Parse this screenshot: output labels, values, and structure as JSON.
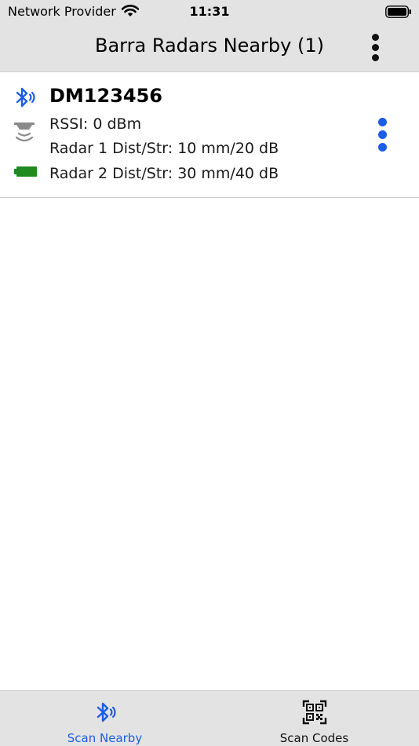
{
  "status_bar": {
    "carrier": "Network Provider",
    "time": "11:31"
  },
  "header": {
    "title": "Barra Radars Nearby (1)"
  },
  "device": {
    "name": "DM123456",
    "rssi": "RSSI: 0 dBm",
    "radar1": "Radar 1 Dist/Str: 10 mm/20 dB",
    "radar2": "Radar 2 Dist/Str: 30 mm/40 dB"
  },
  "tabs": [
    {
      "label": "Scan Nearby",
      "icon": "bluetooth-icon",
      "selected": true
    },
    {
      "label": "Scan Codes",
      "icon": "qr-code-icon",
      "selected": false
    }
  ],
  "colors": {
    "accent": "#1d5de6",
    "bar_background": "#e3e3e3",
    "battery_ok": "#1f8a1f"
  }
}
